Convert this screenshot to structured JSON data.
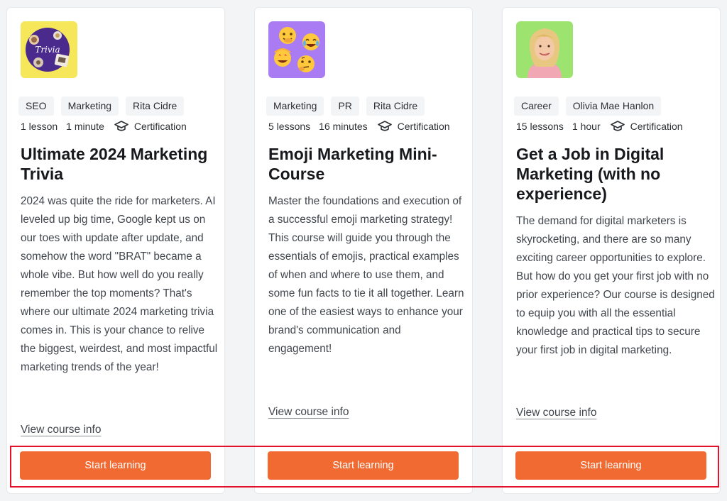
{
  "courses": [
    {
      "thumbnail": {
        "icon": "trivia-icon",
        "bg": "#f5e65a",
        "text": "Trivia"
      },
      "tags": [
        "SEO",
        "Marketing",
        "Rita Cidre"
      ],
      "lessons": "1 lesson",
      "duration": "1 minute",
      "certification": "Certification",
      "title": "Ultimate 2024 Marketing Trivia",
      "description": "2024 was quite the ride for marketers. AI leveled up big time, Google kept us on our toes with update after update, and somehow the word \"BRAT\" became a whole vibe. But how well do you really remember the top moments? That's where our ultimate 2024 marketing trivia comes in. This is your chance to relive the biggest, weirdest, and most impactful marketing trends of the year!",
      "link": "View course info",
      "button": "Start learning"
    },
    {
      "thumbnail": {
        "icon": "emoji-icon",
        "bg": "#a97cf3"
      },
      "tags": [
        "Marketing",
        "PR",
        "Rita Cidre"
      ],
      "lessons": "5 lessons",
      "duration": "16 minutes",
      "certification": "Certification",
      "title": "Emoji Marketing Mini-Course",
      "description": "Master the foundations and execution of a successful emoji marketing strategy! This course will guide you through the essentials of emojis, practical examples of when and where to use them, and some fun facts to tie it all together. Learn one of the easiest ways to enhance your brand's communication and engagement!",
      "link": "View course info",
      "button": "Start learning"
    },
    {
      "thumbnail": {
        "icon": "portrait-icon",
        "bg": "#9de36f"
      },
      "tags": [
        "Career",
        "Olivia Mae Hanlon"
      ],
      "lessons": "15 lessons",
      "duration": "1 hour",
      "certification": "Certification",
      "title": "Get a Job in Digital Marketing (with no experience)",
      "description": "The demand for digital marketers is skyrocketing, and there are so many exciting career opportunities to explore. But how do you get your first job with no prior experience? Our course is designed to equip you with all the essential knowledge and practical tips to secure your first job in digital marketing.",
      "link": "View course info",
      "button": "Start learning"
    }
  ],
  "colors": {
    "accent": "#f06a32",
    "highlight": "#e5112b",
    "card_bg": "#ffffff",
    "page_bg": "#f3f4f6",
    "tag_bg": "#f3f4f6"
  }
}
